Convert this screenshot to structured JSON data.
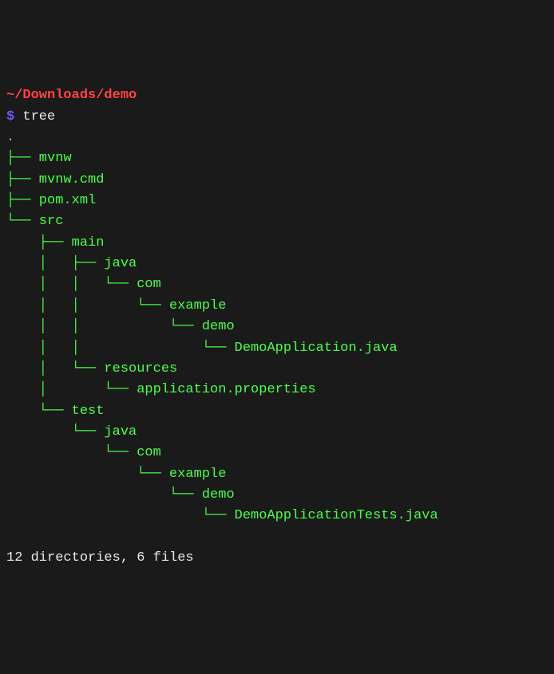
{
  "cwd": "~/Downloads/demo",
  "prompt_symbol": "$ ",
  "command": "tree",
  "tree_lines": [
    ".",
    "├── mvnw",
    "├── mvnw.cmd",
    "├── pom.xml",
    "└── src",
    "    ├── main",
    "    │   ├── java",
    "    │   │   └── com",
    "    │   │       └── example",
    "    │   │           └── demo",
    "    │   │               └── DemoApplication.java",
    "    │   └── resources",
    "    │       └── application.properties",
    "    └── test",
    "        └── java",
    "            └── com",
    "                └── example",
    "                    └── demo",
    "                        └── DemoApplicationTests.java"
  ],
  "summary": "12 directories, 6 files"
}
